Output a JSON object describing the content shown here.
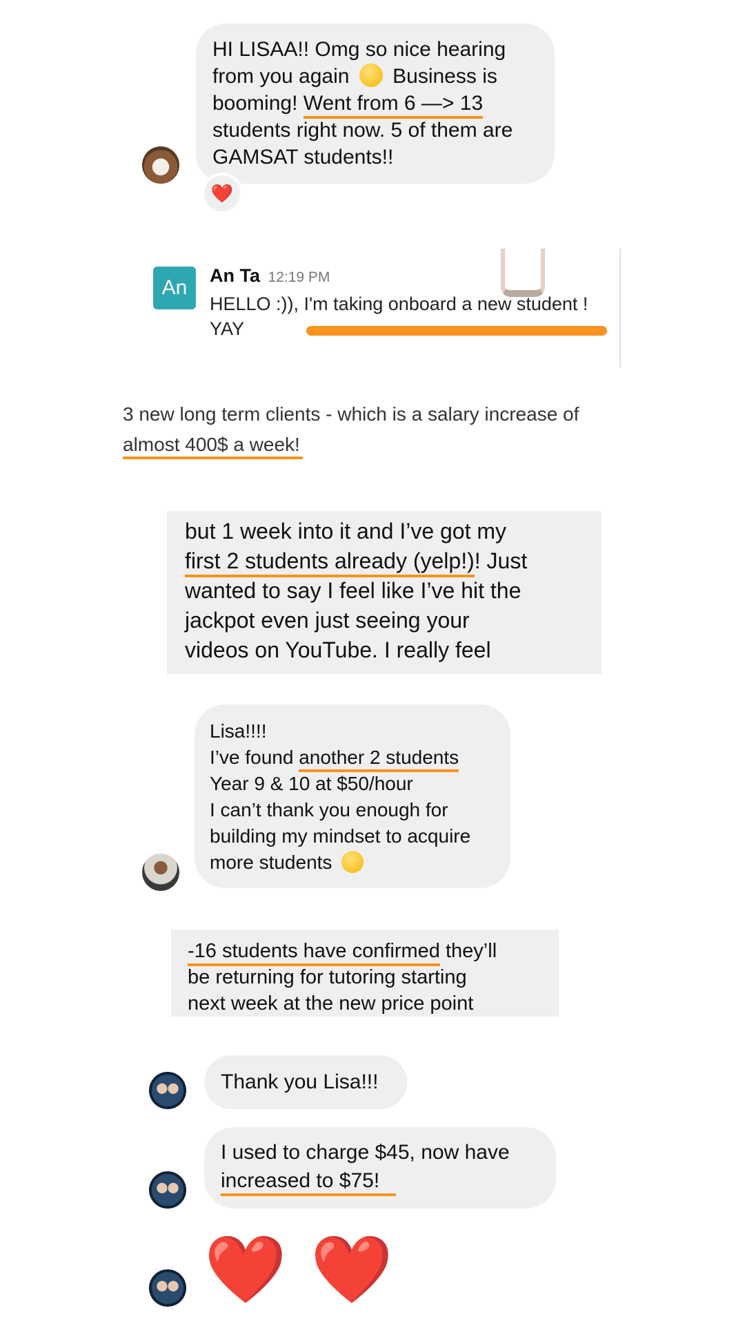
{
  "messages": {
    "m1": {
      "lines": [
        "HI LISAA!! Omg so nice hearing",
        "from you again",
        "Business is",
        "booming!",
        "Went from 6 —> 13",
        "students right now. 5 of them are",
        "GAMSAT students!!"
      ],
      "reaction": "❤️"
    },
    "slack": {
      "avatar_initials": "An",
      "name": "An Ta",
      "time": "12:19 PM",
      "lines": [
        "HELLO :)), I'm taking onboard a new student !",
        "YAY"
      ]
    },
    "review": {
      "lines": [
        "3 new long term clients - which is a salary increase of",
        "almost 400$ a week!"
      ]
    },
    "m3": {
      "lines": [
        "but 1 week into it and I’ve got my",
        "first 2 students already (yelp!)",
        "! Just",
        "wanted to say I feel like I’ve hit the",
        "jackpot even just seeing your",
        "videos on YouTube. I really feel"
      ]
    },
    "m4": {
      "lines": [
        "Lisa!!!!",
        "I’ve found ",
        "another 2 students",
        "Year 9 & 10 at $50/hour",
        "I can’t thank you enough for",
        "building my mindset to acquire",
        "more students"
      ]
    },
    "m5": {
      "lines": [
        "-16 students have confirmed",
        " they’ll",
        "be returning for tutoring starting",
        "next week at the new price point"
      ]
    },
    "m6": {
      "text": "Thank you Lisa!!!"
    },
    "m7": {
      "lines": [
        "I used to charge $45, now have",
        "increased to $75!"
      ]
    },
    "m8": {
      "hearts": [
        "❤️",
        "❤️"
      ]
    }
  },
  "colors": {
    "bubble": "#efefef",
    "underline": "#f7931e",
    "slack_avatar": "#2fa7b3",
    "heart": "#e8162b"
  }
}
